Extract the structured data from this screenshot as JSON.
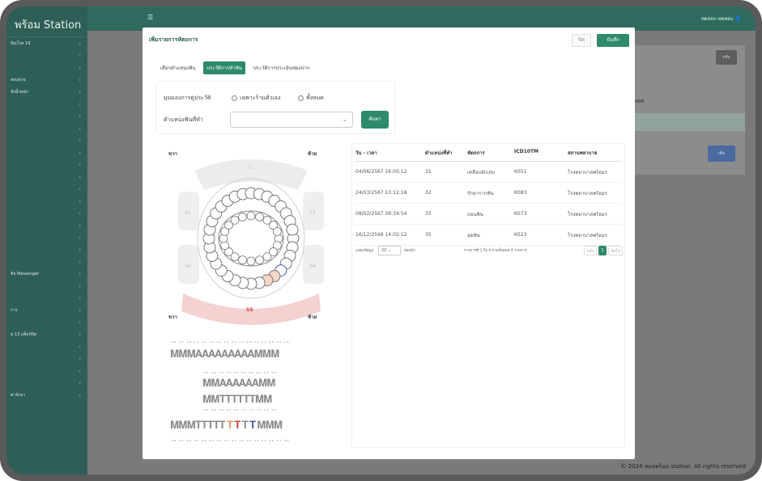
{
  "app": {
    "brand": "พร้อม Station",
    "user": "ทดสอบ ทดสอบ"
  },
  "sidebar": {
    "items": [
      "ปัณโรค 19",
      "",
      "",
      "สอบสวน",
      "ชั่งน้ำหนัก",
      "",
      "",
      "",
      "",
      "",
      "",
      "",
      "",
      "",
      "",
      "",
      "",
      "",
      "",
      "ข้อ Messenger",
      "",
      "",
      "การ",
      "",
      "ม 13 แพ็คกัปัด",
      "",
      "",
      "",
      "",
      "ศาจักษา"
    ]
  },
  "background": {
    "card_label": "พทย์",
    "back_button": "กลับ",
    "add_button": "เพิ่ม",
    "footer": "2024 หมอพร้อม station. All rights reserved"
  },
  "modal": {
    "title": "เพิ่มรายการหัตถการ",
    "close_label": "ปิด",
    "save_label": "บันทึก",
    "tabs": [
      "เลือกตำแหน่งฟัน",
      "ประวัติการทำฟัน",
      "ประวัติการประเมินช่องปาก"
    ],
    "active_tab": 1,
    "filter": {
      "view_label": "มุมมองการดูประวัติ",
      "radio_1": "เฉพาะร้านตัวเอง",
      "radio_2": "ทั้งหมด",
      "position_label": "ตำแหน่งฟันที่ทำ",
      "search_label": "ค้นหา"
    },
    "chart": {
      "left_top": "ขวา",
      "right_top": "ซ้าย",
      "left_bottom": "ขวา",
      "right_bottom": "ซ้าย",
      "ss_top": "S2",
      "ss_bottom": "S5",
      "s1": "S1",
      "s3": "S3",
      "s4": "S4",
      "s6": "S6"
    },
    "table": {
      "headers": [
        "วัน - เวลา",
        "ตำแหน่งที่ทำ",
        "หัตถการ",
        "ICD10TM",
        "สถานพยาบาล"
      ],
      "rows": [
        [
          "04/06/2567 16:05:12",
          "31",
          "เคลือบอักเสบ",
          "K051",
          "โรงพยาบาลพร้อมร"
        ],
        [
          "24/03/2567 13:12:18",
          "32",
          "รักษารากฟัน",
          "K083",
          "โรงพยาบาลพร้อมร"
        ],
        [
          "08/02/2567 09:34:54",
          "33",
          "ถอนฟัน",
          "K073",
          "โรงพยาบาลพร้อมร"
        ],
        [
          "16/12/2566 14:02:12",
          "35",
          "อุดฟัน",
          "K023",
          "โรงพยาบาลพร้อมร"
        ]
      ],
      "pager": {
        "show_label": "แสดงข้อมูล",
        "page_size": "20",
        "per_page": "ต่อหน้า",
        "summary": "รายการที่ 1 ถึง 4 จากทั้งหมด 4 รายการ",
        "prev": "กลับ",
        "page": "1",
        "next": "ถัดไป"
      }
    }
  }
}
